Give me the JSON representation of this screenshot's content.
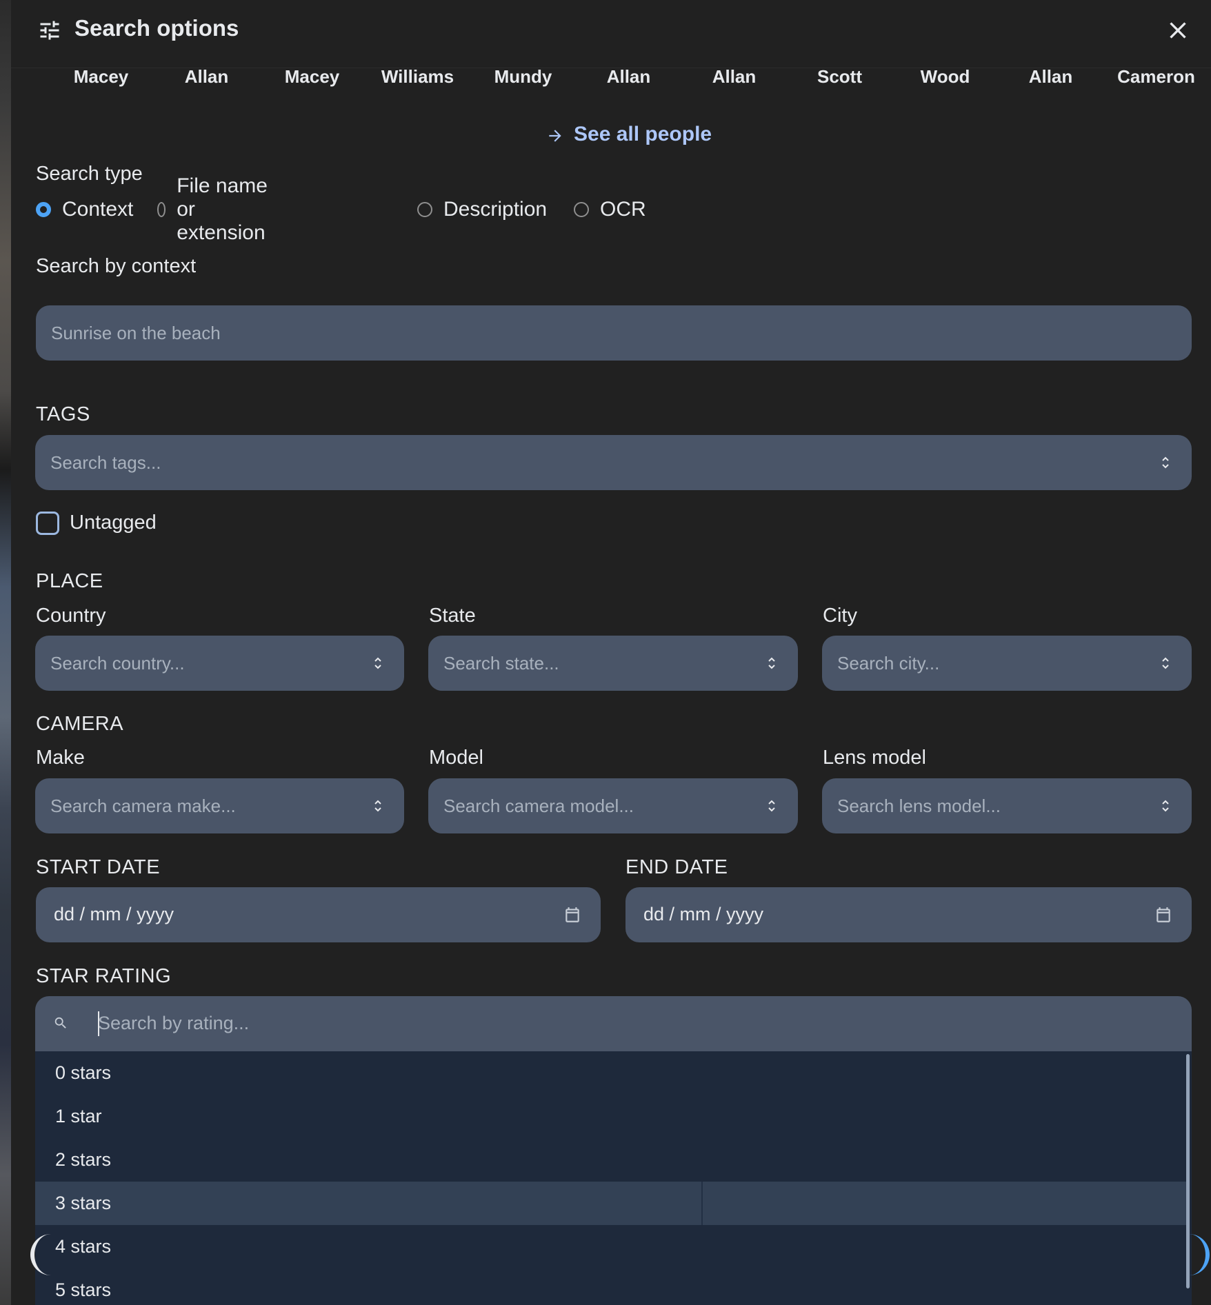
{
  "header": {
    "title": "Search options",
    "icon": "tune-icon",
    "close_icon": "close-icon"
  },
  "people": [
    "Macey",
    "Allan",
    "Macey",
    "Williams",
    "Mundy",
    "Allan",
    "Allan",
    "Scott",
    "Wood",
    "Allan",
    "Cameron"
  ],
  "see_all": {
    "label": "See all people",
    "icon": "arrow-right-icon",
    "color": "#adc7f8"
  },
  "search_type": {
    "label": "Search type",
    "options": [
      "Context",
      "File name or extension",
      "Description",
      "OCR"
    ],
    "selected": "Context",
    "accent": "#4da3f5"
  },
  "search_by_context": {
    "label": "Search by context",
    "placeholder": "Sunrise on the beach"
  },
  "tags": {
    "label": "TAGS",
    "placeholder": "Search tags...",
    "untagged_label": "Untagged"
  },
  "place": {
    "label": "PLACE",
    "country": {
      "label": "Country",
      "placeholder": "Search country..."
    },
    "state": {
      "label": "State",
      "placeholder": "Search state..."
    },
    "city": {
      "label": "City",
      "placeholder": "Search city..."
    }
  },
  "camera": {
    "label": "CAMERA",
    "make": {
      "label": "Make",
      "placeholder": "Search camera make..."
    },
    "model": {
      "label": "Model",
      "placeholder": "Search camera model..."
    },
    "lens": {
      "label": "Lens model",
      "placeholder": "Search lens model..."
    }
  },
  "dates": {
    "start_label": "START DATE",
    "end_label": "END DATE",
    "format": "dd / mm / yyyy"
  },
  "star_rating": {
    "label": "STAR RATING",
    "placeholder": "Search by rating...",
    "options": [
      "0 stars",
      "1 star",
      "2 stars",
      "3 stars",
      "4 stars",
      "5 stars"
    ],
    "highlighted": "3 stars"
  },
  "colors": {
    "background": "#212121",
    "field": "#4a5568",
    "dropdown": "#1e293b",
    "dropdown_hover": "#334155"
  }
}
